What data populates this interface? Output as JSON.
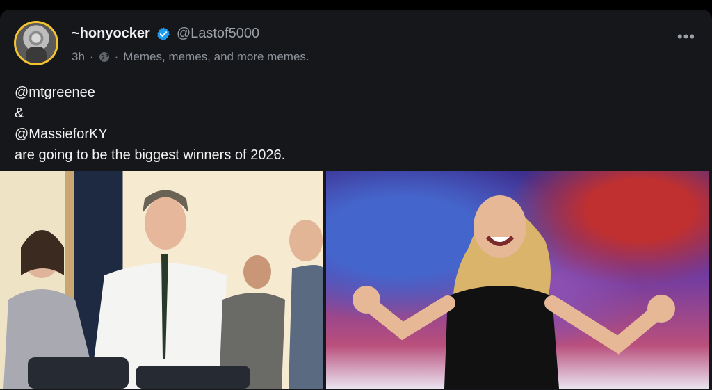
{
  "post": {
    "display_name": "~honyocker",
    "handle": "@Lastof5000",
    "time": "3h",
    "dot": "·",
    "community": "Memes, memes, and more memes.",
    "more_label": "•••",
    "lines": [
      "@mtgreenee",
      "&",
      "@MassieforKY",
      "are going to be the biggest winners of 2026."
    ]
  },
  "icons": {
    "verified": "verified-badge-icon",
    "globe": "globe-icon",
    "more": "more-options-icon"
  },
  "colors": {
    "background": "#000000",
    "card": "#15171b",
    "verified_blue": "#1d9bf0",
    "avatar_ring": "#f4c430",
    "muted_text": "#8d939a"
  }
}
